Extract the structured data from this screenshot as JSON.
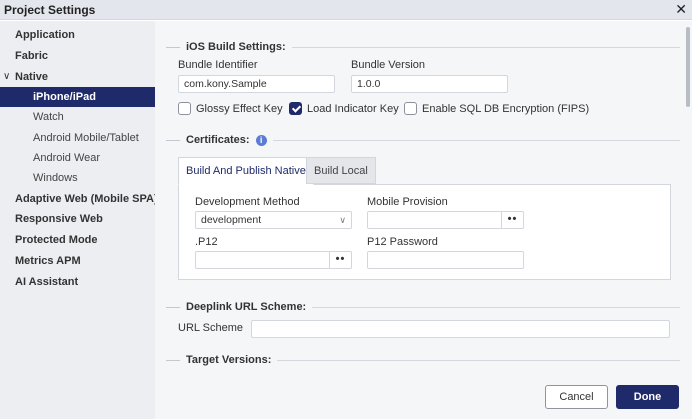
{
  "window": {
    "title": "Project Settings",
    "close_glyph": "✕"
  },
  "sidebar": {
    "items": [
      {
        "label": "Application"
      },
      {
        "label": "Fabric"
      },
      {
        "label": "Native",
        "chevron": "∨"
      },
      {
        "label": "iPhone/iPad"
      },
      {
        "label": "Watch"
      },
      {
        "label": "Android Mobile/Tablet"
      },
      {
        "label": "Android Wear"
      },
      {
        "label": "Windows"
      },
      {
        "label": "Adaptive Web (Mobile SPA)"
      },
      {
        "label": "Responsive Web"
      },
      {
        "label": "Protected Mode"
      },
      {
        "label": "Metrics APM"
      },
      {
        "label": "AI Assistant"
      }
    ]
  },
  "ios_build": {
    "heading": "iOS Build Settings:",
    "bundle_identifier_label": "Bundle Identifier",
    "bundle_identifier_value": "com.kony.Sample",
    "bundle_version_label": "Bundle Version",
    "bundle_version_value": "1.0.0",
    "checkboxes": [
      {
        "label": "Glossy Effect Key",
        "checked": false
      },
      {
        "label": "Load Indicator Key",
        "checked": true
      },
      {
        "label": "Enable SQL DB Encryption (FIPS)",
        "checked": false
      }
    ]
  },
  "certificates": {
    "heading": "Certificates:",
    "info_glyph": "i",
    "tabs": [
      {
        "label": "Build And Publish Native"
      },
      {
        "label": "Build Local"
      }
    ],
    "development_method_label": "Development Method",
    "development_method_value": "development",
    "select_chevron": "∨",
    "mobile_provision_label": "Mobile Provision",
    "mobile_provision_value": "",
    "p12_label": ".P12",
    "p12_value": "",
    "p12_password_label": "P12 Password",
    "p12_password_value": "",
    "browse_glyph": "••"
  },
  "deeplink": {
    "heading": "Deeplink URL Scheme:",
    "url_scheme_label": "URL Scheme",
    "url_scheme_value": ""
  },
  "target_versions": {
    "heading": "Target Versions:"
  },
  "footer": {
    "cancel_label": "Cancel",
    "done_label": "Done"
  }
}
